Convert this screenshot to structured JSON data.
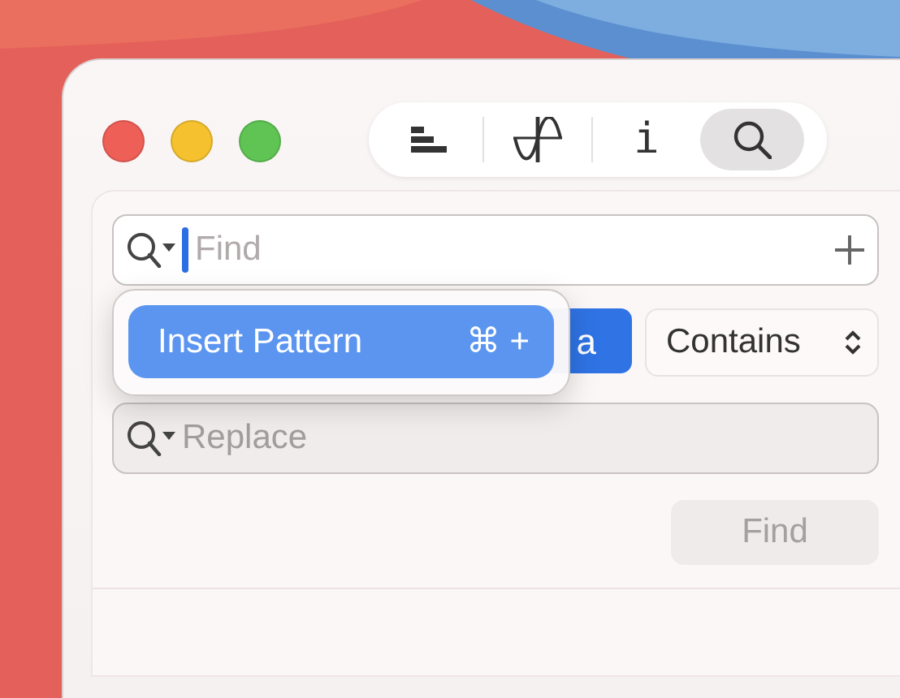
{
  "window": {
    "traffic_lights": [
      {
        "color": "#ee5f57"
      },
      {
        "color": "#f5c12e"
      },
      {
        "color": "#5fc454"
      }
    ]
  },
  "toolbar": {
    "tools": [
      {
        "kind": "list",
        "selected": false
      },
      {
        "kind": "wave",
        "selected": false
      },
      {
        "kind": "info",
        "label": "i",
        "selected": false
      },
      {
        "kind": "search",
        "selected": true
      }
    ]
  },
  "find_field": {
    "placeholder": "Find",
    "focused": true
  },
  "options": {
    "match_button": {
      "label": "a",
      "selected": true
    },
    "mode_popup": {
      "label": "Contains"
    }
  },
  "pattern_menu": {
    "items": [
      {
        "label": "Insert Pattern",
        "shortcut": "⌘ +",
        "selected": true
      }
    ]
  },
  "replace_field": {
    "placeholder": "Replace"
  },
  "find_button": {
    "label": "Find",
    "disabled": true
  }
}
